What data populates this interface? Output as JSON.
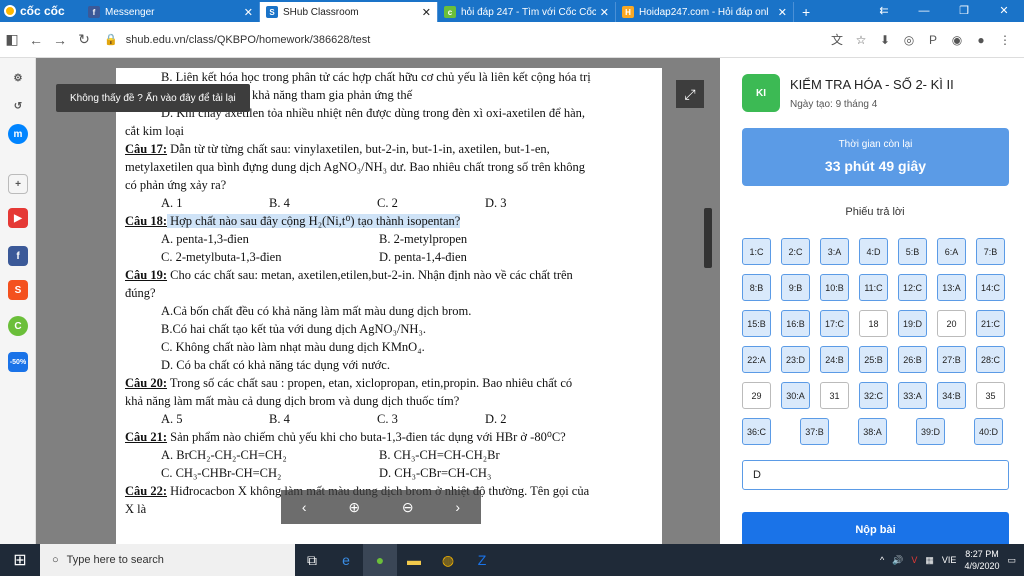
{
  "browser": {
    "logo": "cốc cốc",
    "tabs": [
      {
        "title": "Messenger",
        "icon": "f",
        "color": "#3b5998"
      },
      {
        "title": "SHub Classroom",
        "icon": "S",
        "color": "#1a73c8",
        "active": true
      },
      {
        "title": "hỏi đáp 247 - Tìm với Cốc Cốc",
        "icon": "c",
        "color": "#6bbf3a"
      },
      {
        "title": "Hoidap247.com - Hỏi đáp onl",
        "icon": "H",
        "color": "#f9a825"
      }
    ],
    "url": "shub.edu.vn/class/QKBPO/homework/386628/test"
  },
  "viewer": {
    "badge": "Không thấy đề ? Ấn vào đây để tải lại",
    "lines": [
      {
        "t": "B. Liên kết hóa học trong phân tử các hợp chất hữu cơ chủ yếu là liên kết cộng hóa trị",
        "c": "ind"
      },
      {
        "t": "C. Số chất nào có khả năng tham gia phản ứng thế",
        "c": "ind"
      },
      {
        "t": "D. Khi cháy axetilen tỏa nhiều nhiệt nên được dùng trong đèn xì oxi-axetilen để hàn,",
        "c": "ind"
      },
      {
        "t": "cắt kim loại",
        "c": ""
      },
      {
        "q": "Câu 17:",
        "t": " Dẫn từ từ từng chất sau: vinylaxetilen, but-2-in, but-1-in, axetilen, but-1-en,",
        "c": ""
      },
      {
        "t": "metylaxetilen qua bình đựng dung dịch AgNO₃/NH₃ dư. Bao nhiêu chất trong số trên không",
        "c": ""
      },
      {
        "t": "có phản ứng xảy ra?",
        "c": ""
      },
      {
        "opts": [
          "A. 1",
          "B. 4",
          "C. 2",
          "D. 3"
        ]
      },
      {
        "q": "Câu 18:",
        "t": " Hợp chất nào sau đây cộng H₂(Ni,t⁰) tạo thành isopentan?",
        "c": "",
        "hl": true
      },
      {
        "opts": [
          "A. penta-1,3-đien",
          "B. 2-metylpropen"
        ],
        "wide": true
      },
      {
        "opts": [
          "C. 2-metylbuta-1,3-đien",
          "D. penta-1,4-đien"
        ],
        "wide": true
      },
      {
        "q": "Câu 19:",
        "t": " Cho các chất sau: metan, axetilen,etilen,but-2-in. Nhận định nào về các chất trên",
        "c": ""
      },
      {
        "t": "đúng?",
        "c": ""
      },
      {
        "t": "A.Cả bốn chất đều có khả năng làm mất màu dung dịch brom.",
        "c": "ind"
      },
      {
        "t": "B.Có hai chất tạo kết tủa với dung dịch AgNO₃/NH₃.",
        "c": "ind"
      },
      {
        "t": "C. Không chất nào làm nhạt màu dung dịch KMnO₄.",
        "c": "ind"
      },
      {
        "t": "D. Có ba chất có khả năng tác dụng với nước.",
        "c": "ind"
      },
      {
        "q": "Câu 20:",
        "t": " Trong số các chất sau : propen, etan, xiclopropan, etin,propin. Bao nhiêu chất có",
        "c": ""
      },
      {
        "t": "khả năng làm mất màu cả dung dịch brom và dung dịch thuốc tím?",
        "c": ""
      },
      {
        "opts": [
          "A. 5",
          "B. 4",
          "C. 3",
          "D. 2"
        ]
      },
      {
        "q": "Câu 21:",
        "t": " Sản phẩm nào chiếm chủ yếu khi cho buta-1,3-đien tác dụng với HBr ở -80⁰C?",
        "c": ""
      },
      {
        "opts": [
          "A. BrCH₂-CH₂-CH=CH₂",
          "B. CH₃-CH=CH-CH₂Br"
        ],
        "wide": true
      },
      {
        "opts": [
          "C. CH₃-CHBr-CH=CH₂",
          "D. CH₃-CBr=CH-CH₃"
        ],
        "wide": true
      },
      {
        "q": "Câu 22:",
        "t": " Hiđrocacbon X không làm mất màu dung dịch brom ở nhiệt độ thường. Tên gọi của",
        "c": ""
      },
      {
        "t": "X là",
        "c": ""
      }
    ]
  },
  "test": {
    "avatar": "KI",
    "title": "KIỂM TRA HÓA - SỐ 2- KÌ II",
    "date": "Ngày tạo: 9 tháng 4",
    "timer_label": "Thời gian còn lại",
    "timer_value": "33 phút 49 giây",
    "sheet_title": "Phiếu trả lời",
    "answers": [
      "1:C",
      "2:C",
      "3:A",
      "4:D",
      "5:B",
      "6:A",
      "7:B",
      "8:B",
      "9:B",
      "10:B",
      "11:C",
      "12:C",
      "13:A",
      "14:C",
      "15:B",
      "16:B",
      "17:C",
      "18",
      "19:D",
      "20",
      "21:C",
      "22:A",
      "23:D",
      "24:B",
      "25:B",
      "26:B",
      "27:B",
      "28:C",
      "29",
      "30:A",
      "31",
      "32:C",
      "33:A",
      "34:B",
      "35",
      "36:C",
      "37:B",
      "38:A",
      "39:D",
      "40:D"
    ],
    "answer_value": "D",
    "submit": "Nộp bài"
  },
  "taskbar": {
    "search": "Type here to search",
    "time": "8:27 PM",
    "date": "4/9/2020",
    "lang": "VIE"
  }
}
